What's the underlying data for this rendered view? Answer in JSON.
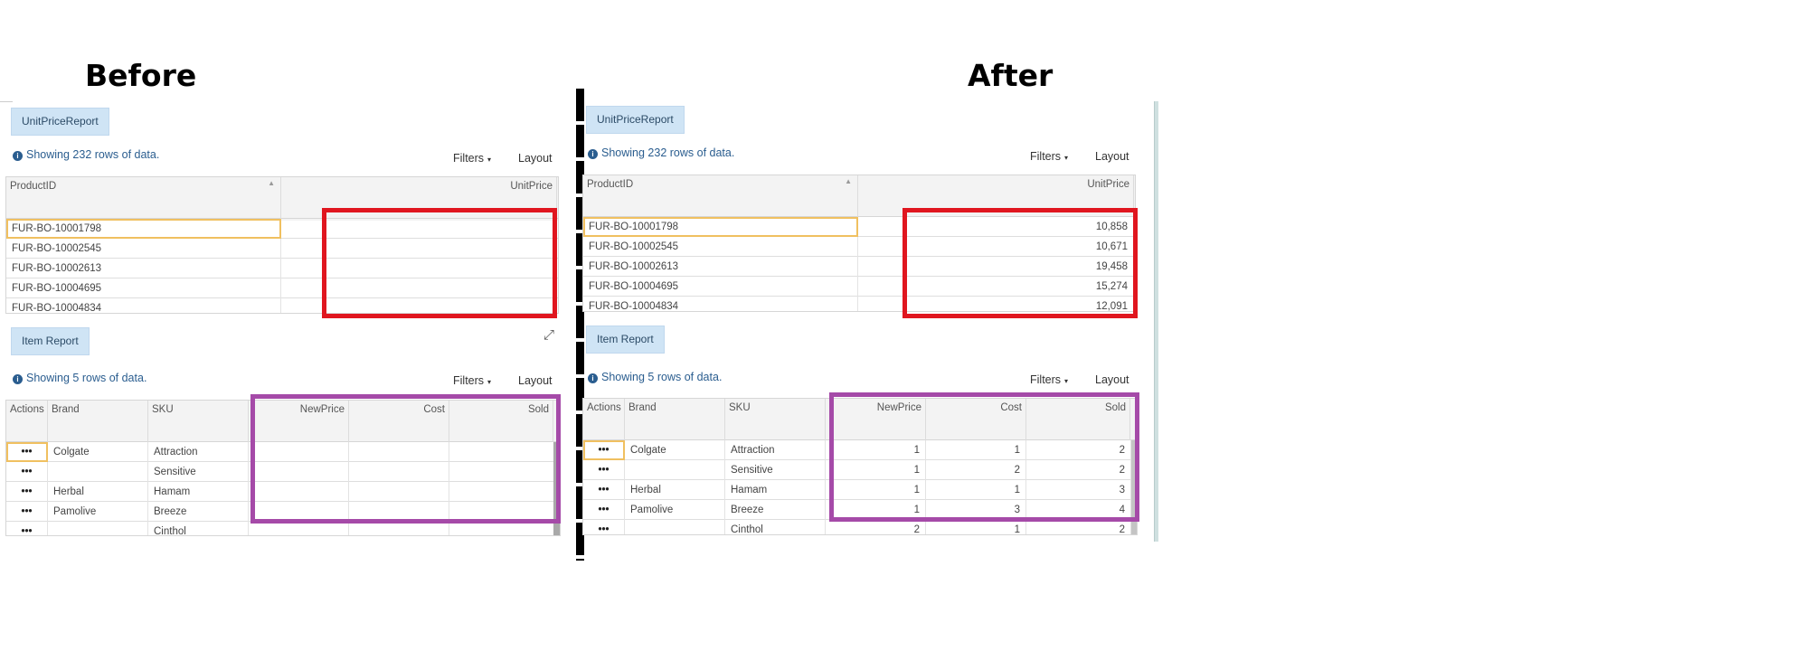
{
  "titles": {
    "before": "Before",
    "after": "After"
  },
  "unit_price_report": {
    "button_label": "UnitPriceReport",
    "info": "Showing 232 rows of data.",
    "filters_label": "Filters",
    "layout_label": "Layout",
    "columns": [
      "ProductID",
      "UnitPrice"
    ],
    "product_ids": [
      "FUR-BO-10001798",
      "FUR-BO-10002545",
      "FUR-BO-10002613",
      "FUR-BO-10004695",
      "FUR-BO-10004834"
    ],
    "unit_prices_after": [
      "10,858",
      "10,671",
      "19,458",
      "15,274",
      "12,091"
    ]
  },
  "item_report": {
    "button_label": "Item Report",
    "info": "Showing 5 rows of data.",
    "filters_label": "Filters",
    "layout_label": "Layout",
    "columns": [
      "Actions",
      "Brand",
      "SKU",
      "NewPrice",
      "Cost",
      "Sold"
    ],
    "action_label": "•••",
    "rows": [
      {
        "brand": "Colgate",
        "sku": "Attraction",
        "newprice": "1",
        "cost": "1",
        "sold": "2"
      },
      {
        "brand": "",
        "sku": "Sensitive",
        "newprice": "1",
        "cost": "2",
        "sold": "2"
      },
      {
        "brand": "Herbal",
        "sku": "Hamam",
        "newprice": "1",
        "cost": "1",
        "sold": "3"
      },
      {
        "brand": "Pamolive",
        "sku": "Breeze",
        "newprice": "1",
        "cost": "3",
        "sold": "4"
      },
      {
        "brand": "",
        "sku": "Cinthol",
        "newprice": "2",
        "cost": "1",
        "sold": "2"
      }
    ]
  },
  "icons": {
    "info": "info-icon",
    "filters_caret": "caret-down-icon",
    "sort": "sort-asc-icon",
    "expand": "expand-icon"
  },
  "colors": {
    "highlight_red": "#e0161f",
    "highlight_purple": "#a54aa8",
    "selection": "#f0c060"
  }
}
